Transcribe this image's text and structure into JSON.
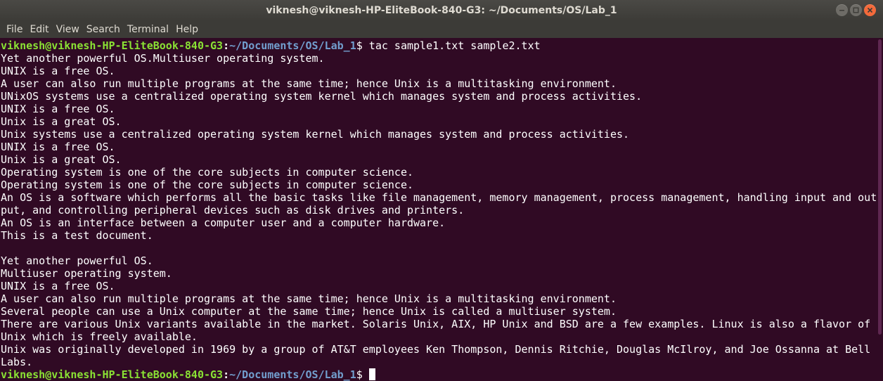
{
  "window": {
    "title": "viknesh@viknesh-HP-EliteBook-840-G3: ~/Documents/OS/Lab_1"
  },
  "menu": {
    "items": [
      "File",
      "Edit",
      "View",
      "Search",
      "Terminal",
      "Help"
    ]
  },
  "prompt": {
    "user_host": "viknesh@viknesh-HP-EliteBook-840-G3",
    "colon": ":",
    "path": "~/Documents/OS/Lab_1",
    "symbol": "$ ",
    "command": "tac sample1.txt sample2.txt"
  },
  "output": [
    "Yet another powerful OS.Multiuser operating system.",
    "UNIX is a free OS.",
    "A user can also run multiple programs at the same time; hence Unix is a multitasking environment.",
    "UNixOS systems use a centralized operating system kernel which manages system and process activities.",
    "UNIX is a free OS.",
    "Unix is a great OS.",
    "Unix systems use a centralized operating system kernel which manages system and process activities.",
    "UNIX is a free OS.",
    "Unix is a great OS.",
    "Operating system is one of the core subjects in computer science.",
    "Operating system is one of the core subjects in computer science.",
    "An OS is a software which performs all the basic tasks like file management, memory management, process management, handling input and out",
    "put, and controlling peripheral devices such as disk drives and printers.",
    "An OS is an interface between a computer user and a computer hardware.",
    "This is a test document.",
    "",
    "Yet another powerful OS.",
    "Multiuser operating system.",
    "UNIX is a free OS.",
    "A user can also run multiple programs at the same time; hence Unix is a multitasking environment.",
    "Several people can use a Unix computer at the same time; hence Unix is called a multiuser system.",
    "There are various Unix variants available in the market. Solaris Unix, AIX, HP Unix and BSD are a few examples. Linux is also a flavor of",
    "Unix which is freely available.",
    "Unix was originally developed in 1969 by a group of AT&T employees Ken Thompson, Dennis Ritchie, Douglas McIlroy, and Joe Ossanna at Bell",
    "Labs."
  ],
  "colors": {
    "background": "#300a24",
    "prompt_user": "#8ae234",
    "prompt_path": "#729fcf",
    "text": "#ffffff"
  }
}
